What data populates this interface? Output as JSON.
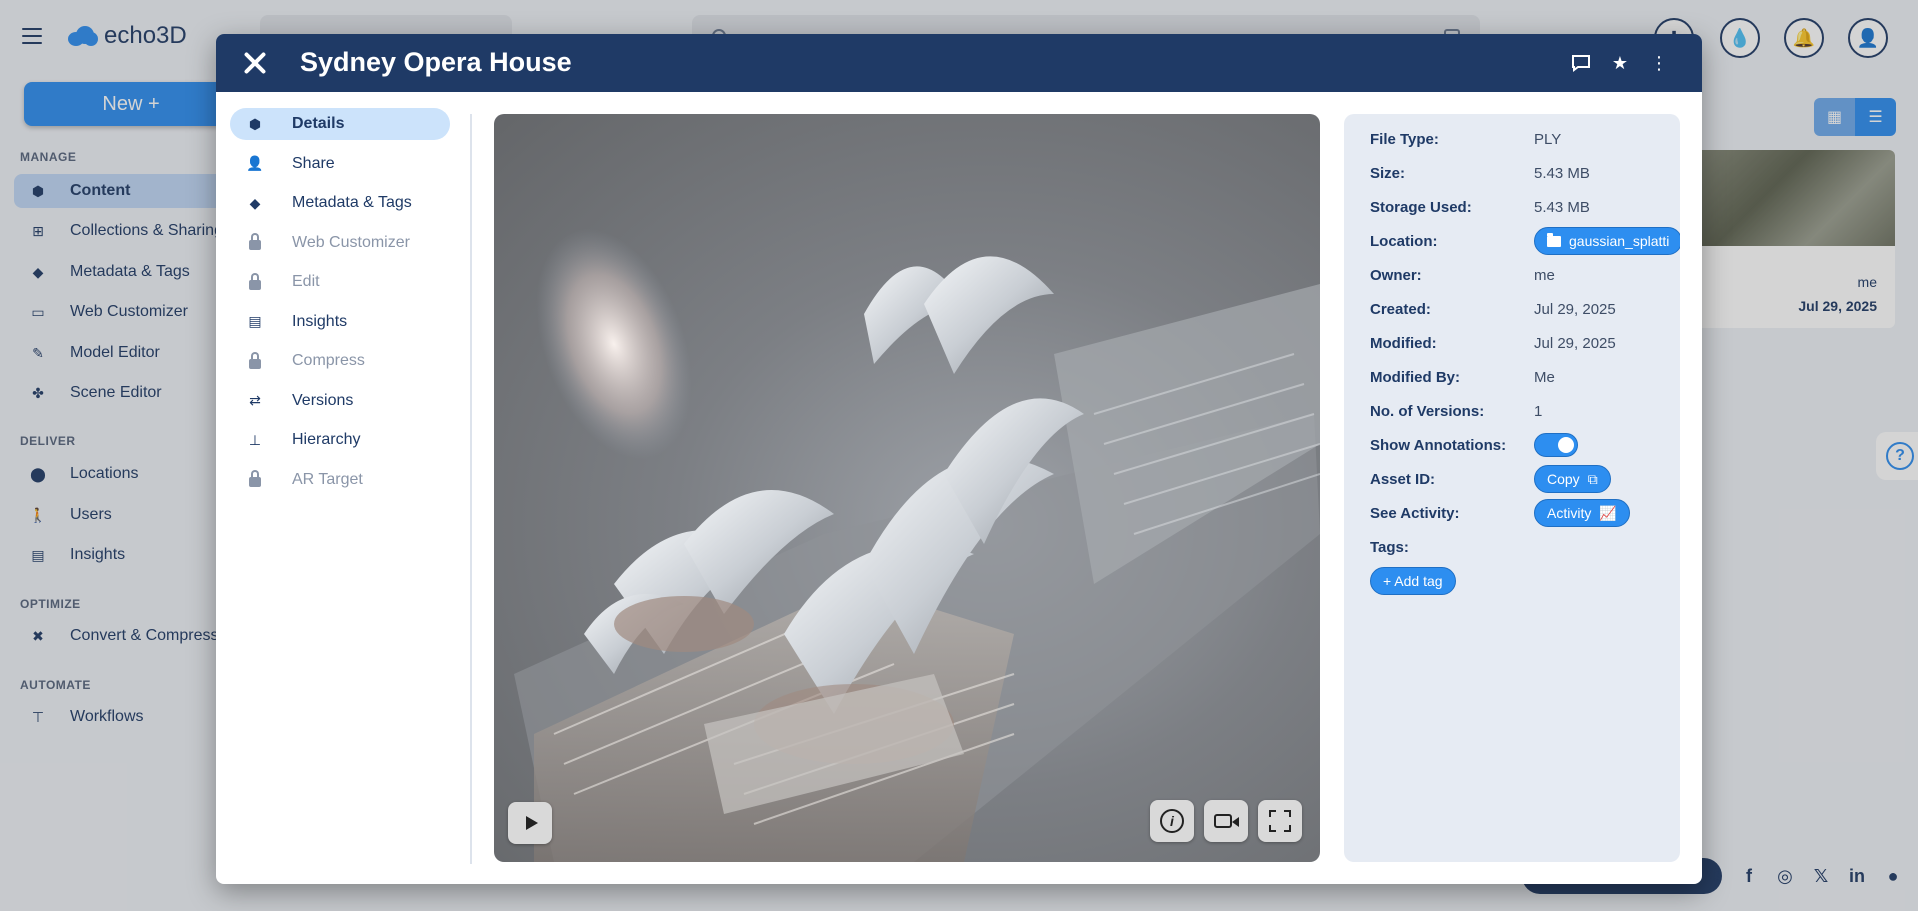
{
  "app": {
    "logo_text": "echo3D",
    "project_name": "",
    "search_placeholder": ""
  },
  "sidebar": {
    "new_button": "New +",
    "sections": {
      "manage": "MANAGE",
      "deliver": "DELIVER",
      "optimize": "OPTIMIZE",
      "automate": "AUTOMATE"
    },
    "items": [
      {
        "label": "Content",
        "icon": "cube-icon"
      },
      {
        "label": "Collections & Sharing",
        "icon": "grid-icon"
      },
      {
        "label": "Metadata & Tags",
        "icon": "tag-icon"
      },
      {
        "label": "Web Customizer",
        "icon": "vr-headset-icon"
      },
      {
        "label": "Model Editor",
        "icon": "pencil-icon"
      },
      {
        "label": "Scene Editor",
        "icon": "shapes-icon"
      },
      {
        "label": "Locations",
        "icon": "map-pin-icon"
      },
      {
        "label": "Users",
        "icon": "person-icon"
      },
      {
        "label": "Insights",
        "icon": "chart-icon"
      },
      {
        "label": "Convert & Compress",
        "icon": "compress-icon"
      },
      {
        "label": "Workflows",
        "icon": "workflow-icon"
      }
    ]
  },
  "background_card": {
    "owner": "me",
    "date": "Jul 29, 2025"
  },
  "modal": {
    "title": "Sydney Opera House",
    "tabs": [
      {
        "label": "Details",
        "icon": "cube-icon",
        "locked": false,
        "active": true
      },
      {
        "label": "Share",
        "icon": "add-user-icon",
        "locked": false
      },
      {
        "label": "Metadata & Tags",
        "icon": "tag-icon",
        "locked": false
      },
      {
        "label": "Web Customizer",
        "icon": "lock-icon",
        "locked": true
      },
      {
        "label": "Edit",
        "icon": "lock-icon",
        "locked": true
      },
      {
        "label": "Insights",
        "icon": "chart-icon",
        "locked": false
      },
      {
        "label": "Compress",
        "icon": "lock-icon",
        "locked": true
      },
      {
        "label": "Versions",
        "icon": "versions-icon",
        "locked": false
      },
      {
        "label": "Hierarchy",
        "icon": "hierarchy-icon",
        "locked": false
      },
      {
        "label": "AR Target",
        "icon": "lock-icon",
        "locked": true
      }
    ],
    "details": {
      "file_type": {
        "label": "File Type:",
        "value": "PLY"
      },
      "size": {
        "label": "Size:",
        "value": "5.43 MB"
      },
      "storage": {
        "label": "Storage Used:",
        "value": "5.43 MB"
      },
      "location": {
        "label": "Location:",
        "value": "gaussian_splatti"
      },
      "owner": {
        "label": "Owner:",
        "value": "me"
      },
      "created": {
        "label": "Created:",
        "value": "Jul 29, 2025"
      },
      "modified": {
        "label": "Modified:",
        "value": "Jul 29, 2025"
      },
      "modified_by": {
        "label": "Modified By:",
        "value": "Me"
      },
      "versions": {
        "label": "No. of Versions:",
        "value": "1"
      },
      "annotations": {
        "label": "Show Annotations:",
        "enabled": true
      },
      "asset_id": {
        "label": "Asset ID:",
        "button": "Copy"
      },
      "activity": {
        "label": "See Activity:",
        "button": "Activity"
      },
      "tags": {
        "label": "Tags:",
        "button": "+ Add tag"
      }
    }
  },
  "colors": {
    "primary_dark": "#1f3a66",
    "accent_blue": "#2d8ef0",
    "active_tab": "#cce3fb",
    "details_panel": "#e6ebf3"
  }
}
